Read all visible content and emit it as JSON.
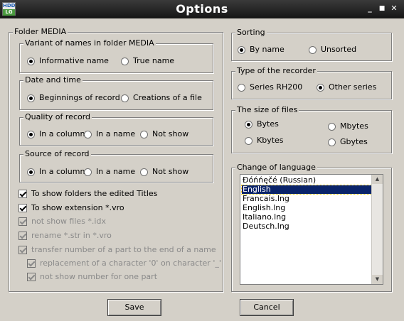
{
  "window": {
    "title": "Options",
    "icon_line1": "HDD",
    "icon_line2": "LG"
  },
  "folder_media": {
    "label": "Folder MEDIA",
    "variant": {
      "label": "Variant of names in folder MEDIA",
      "options": [
        "Informative name",
        "True name"
      ],
      "selected": 0
    },
    "date_time": {
      "label": "Date and time",
      "options": [
        "Beginnings of record",
        "Creations of a file"
      ],
      "selected": 0
    },
    "quality": {
      "label": "Quality of record",
      "options": [
        "In a column",
        "In a name",
        "Not show"
      ],
      "selected": 0
    },
    "source": {
      "label": "Source of record",
      "options": [
        "In a column",
        "In a name",
        "Not show"
      ],
      "selected": 0
    },
    "checks": [
      {
        "label": "To show folders the edited Titles",
        "checked": true,
        "enabled": true
      },
      {
        "label": "To show extension *.vro",
        "checked": true,
        "enabled": true
      },
      {
        "label": "not show files *.idx",
        "checked": true,
        "enabled": false
      },
      {
        "label": "rename *.str in *.vro",
        "checked": true,
        "enabled": false
      },
      {
        "label": "transfer number of a part to the end of a name",
        "checked": true,
        "enabled": false
      },
      {
        "label": "replacement of a character '0' on character '_'",
        "checked": true,
        "enabled": false
      },
      {
        "label": "not show number for one part",
        "checked": true,
        "enabled": false
      }
    ]
  },
  "sorting": {
    "label": "Sorting",
    "options": [
      "By name",
      "Unsorted"
    ],
    "selected": 0
  },
  "recorder": {
    "label": "Type of the recorder",
    "options": [
      "Series RH200",
      "Other series"
    ],
    "selected": 1
  },
  "file_size": {
    "label": "The size of files",
    "options": [
      "Bytes",
      "Mbytes",
      "Kbytes",
      "Gbytes"
    ],
    "selected": 0
  },
  "language": {
    "label": "Change of language",
    "items": [
      "Đóńńęčé (Russian)",
      "English",
      "Francais.lng",
      "English.lng",
      "Italiano.lng",
      "Deutsch.lng"
    ],
    "selected": 1
  },
  "buttons": {
    "save": "Save",
    "cancel": "Cancel"
  }
}
